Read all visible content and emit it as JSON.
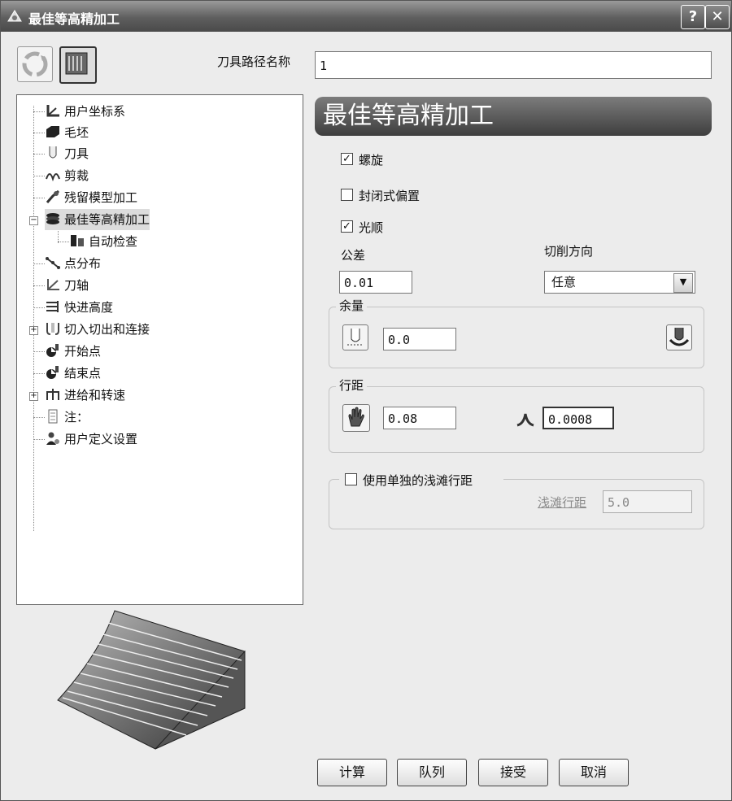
{
  "window": {
    "title": "最佳等高精加工",
    "help": "?",
    "close": "✕"
  },
  "toolpath_name": {
    "label": "刀具路径名称",
    "value": "1"
  },
  "tree": {
    "items": [
      {
        "label": "用户坐标系"
      },
      {
        "label": "毛坯"
      },
      {
        "label": "刀具"
      },
      {
        "label": "剪裁"
      },
      {
        "label": "残留模型加工"
      },
      {
        "label": "最佳等高精加工",
        "expander": "−",
        "selected": true
      },
      {
        "label": "自动检查"
      },
      {
        "label": "点分布"
      },
      {
        "label": "刀轴"
      },
      {
        "label": "快进高度"
      },
      {
        "label": "切入切出和连接",
        "expander": "+"
      },
      {
        "label": "开始点"
      },
      {
        "label": "结束点"
      },
      {
        "label": "进给和转速",
        "expander": "+"
      },
      {
        "label": "注："
      },
      {
        "label": "用户定义设置"
      }
    ]
  },
  "panel": {
    "header": "最佳等高精加工",
    "spiral": {
      "label": "螺旋",
      "checked": true,
      "mark": "✓"
    },
    "closed_offset": {
      "label": "封闭式偏置",
      "checked": false,
      "mark": ""
    },
    "smooth": {
      "label": "光顺",
      "checked": true,
      "mark": "✓"
    },
    "tolerance": {
      "label": "公差",
      "value": "0.01"
    },
    "cut_direction": {
      "label": "切削方向",
      "value": "任意",
      "arrow": "▼"
    },
    "thickness": {
      "label": "余量",
      "value": "0.0"
    },
    "stepover": {
      "label": "行距",
      "value": "0.08",
      "cusp_value": "0.0008"
    },
    "shallow": {
      "label": "使用单独的浅滩行距",
      "checked": false,
      "mark": "",
      "stepover_label": "浅滩行距",
      "stepover_value": "5.0"
    }
  },
  "buttons": {
    "calculate": "计算",
    "queue": "队列",
    "accept": "接受",
    "cancel": "取消"
  },
  "colors": {
    "header_bg": "#4a4a4a",
    "titlebar_bg": "#606060"
  }
}
